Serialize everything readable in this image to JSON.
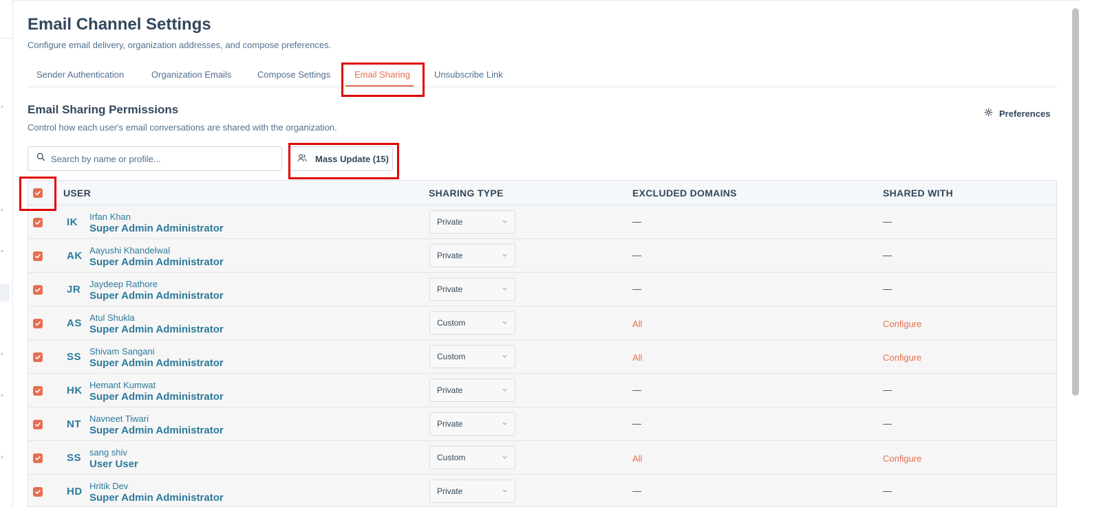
{
  "page": {
    "title": "Email Channel Settings",
    "subtitle": "Configure email delivery, organization addresses, and compose preferences."
  },
  "tabs": [
    {
      "label": "Sender Authentication",
      "active": false
    },
    {
      "label": "Organization Emails",
      "active": false
    },
    {
      "label": "Compose Settings",
      "active": false
    },
    {
      "label": "Email Sharing",
      "active": true
    },
    {
      "label": "Unsubscribe Link",
      "active": false
    }
  ],
  "section": {
    "title": "Email Sharing Permissions",
    "subtitle": "Control how each user's email conversations are shared with the organization.",
    "preferences_label": "Preferences"
  },
  "search": {
    "placeholder": "Search by name or profile...",
    "value": ""
  },
  "mass_update": {
    "label": "Mass Update (15)"
  },
  "table": {
    "headers": {
      "user": "USER",
      "sharing_type": "SHARING TYPE",
      "excluded_domains": "EXCLUDED DOMAINS",
      "shared_with": "SHARED WITH"
    },
    "all_selected": true,
    "rows": [
      {
        "initials": "IK",
        "name": "Irfan Khan",
        "role": "Super Admin Administrator",
        "sharing_type": "Private",
        "excluded_domains": "—",
        "shared_with": "—",
        "checked": true
      },
      {
        "initials": "AK",
        "name": "Aayushi Khandelwal",
        "role": "Super Admin Administrator",
        "sharing_type": "Private",
        "excluded_domains": "—",
        "shared_with": "—",
        "checked": true
      },
      {
        "initials": "JR",
        "name": "Jaydeep Rathore",
        "role": "Super Admin Administrator",
        "sharing_type": "Private",
        "excluded_domains": "—",
        "shared_with": "—",
        "checked": true
      },
      {
        "initials": "AS",
        "name": "Atul Shukla",
        "role": "Super Admin Administrator",
        "sharing_type": "Custom",
        "excluded_domains": "All",
        "shared_with": "Configure",
        "checked": true
      },
      {
        "initials": "SS",
        "name": "Shivam Sangani",
        "role": "Super Admin Administrator",
        "sharing_type": "Custom",
        "excluded_domains": "All",
        "shared_with": "Configure",
        "checked": true
      },
      {
        "initials": "HK",
        "name": "Hemant Kumwat",
        "role": "Super Admin Administrator",
        "sharing_type": "Private",
        "excluded_domains": "—",
        "shared_with": "—",
        "checked": true
      },
      {
        "initials": "NT",
        "name": "Navneet Tiwari",
        "role": "Super Admin Administrator",
        "sharing_type": "Private",
        "excluded_domains": "—",
        "shared_with": "—",
        "checked": true
      },
      {
        "initials": "SS",
        "name": "sang shiv",
        "role": "User User",
        "sharing_type": "Custom",
        "excluded_domains": "All",
        "shared_with": "Configure",
        "checked": true
      },
      {
        "initials": "HD",
        "name": "Hritik Dev",
        "role": "Super Admin Administrator",
        "sharing_type": "Private",
        "excluded_domains": "—",
        "shared_with": "—",
        "checked": true
      }
    ]
  },
  "colors": {
    "accent": "#e66e50",
    "link": "#2c7a9b",
    "text": "#33475b",
    "highlight_box": "#e00000"
  }
}
